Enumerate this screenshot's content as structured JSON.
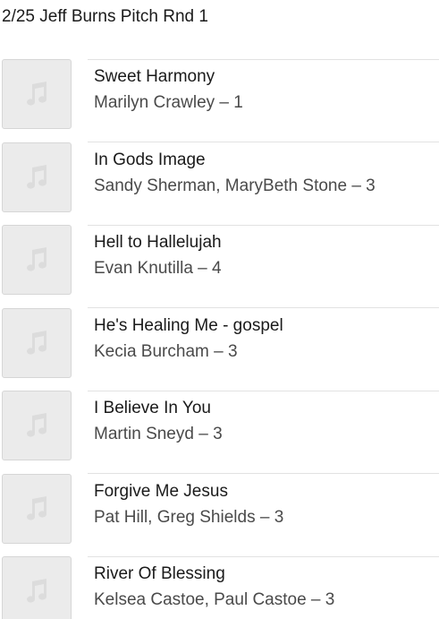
{
  "playlist": {
    "title": "2/25 Jeff Burns Pitch Rnd 1"
  },
  "tracks": [
    {
      "title": "Sweet Harmony",
      "artist": "Marilyn Crawley – 1",
      "artwork_icon": "music-note-icon"
    },
    {
      "title": "In Gods Image",
      "artist": "Sandy Sherman, MaryBeth Stone – 3",
      "artwork_icon": "music-note-icon"
    },
    {
      "title": "Hell to Hallelujah",
      "artist": "Evan Knutilla – 4",
      "artwork_icon": "music-note-icon"
    },
    {
      "title": "He's Healing Me - gospel",
      "artist": "Kecia Burcham – 3",
      "artwork_icon": "music-note-icon"
    },
    {
      "title": "I Believe In You",
      "artist": "Martin Sneyd – 3",
      "artwork_icon": "music-note-icon"
    },
    {
      "title": "Forgive Me Jesus",
      "artist": "Pat Hill, Greg Shields – 3",
      "artwork_icon": "music-note-icon"
    },
    {
      "title": "River Of Blessing",
      "artist": "Kelsea Castoe, Paul Castoe – 3",
      "artwork_icon": "music-note-icon"
    }
  ],
  "colors": {
    "artwork_background": "#ebebeb",
    "music_note": "#dcdcdc",
    "divider": "#e2e2e2"
  }
}
